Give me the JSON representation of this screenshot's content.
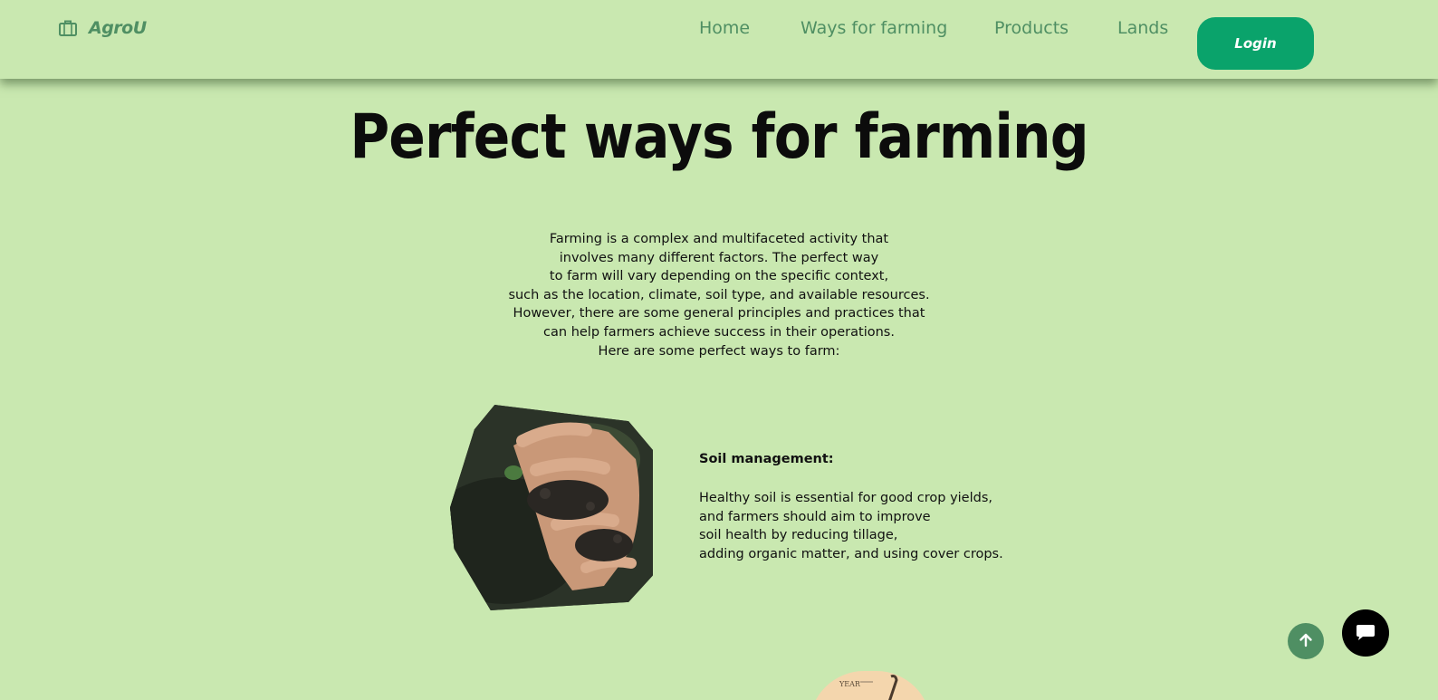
{
  "nav": {
    "brand": "AgroU",
    "brand_icon": "briefcase-icon",
    "links": [
      "Home",
      "Ways for farming",
      "Products",
      "Lands"
    ],
    "login": "Login"
  },
  "hero": {
    "title": "Perfect ways for farming",
    "intro_lines": [
      "Farming is a complex and multifaceted activity that",
      "involves many different factors. The perfect way",
      "to farm will vary depending on the specific context,",
      "such as the location, climate, soil type, and available resources.",
      "However, there are some general principles and practices that",
      "can help farmers achieve success in their operations.",
      "Here are some perfect ways to farm:"
    ]
  },
  "sections": [
    {
      "heading": "Soil management:",
      "lines": [
        "Healthy soil is essential for good crop yields,",
        "and farmers should aim to improve",
        "soil health by reducing tillage,",
        "adding organic matter, and using cover crops."
      ]
    }
  ],
  "next_image_text": "YEAR",
  "widgets": {
    "scroll_top_icon": "arrow-up-icon",
    "chat_icon": "chat-bubble-icon"
  },
  "colors": {
    "background": "#c9e8b0",
    "brand_green": "#4f8f63",
    "login_bg": "#0aa36b"
  }
}
